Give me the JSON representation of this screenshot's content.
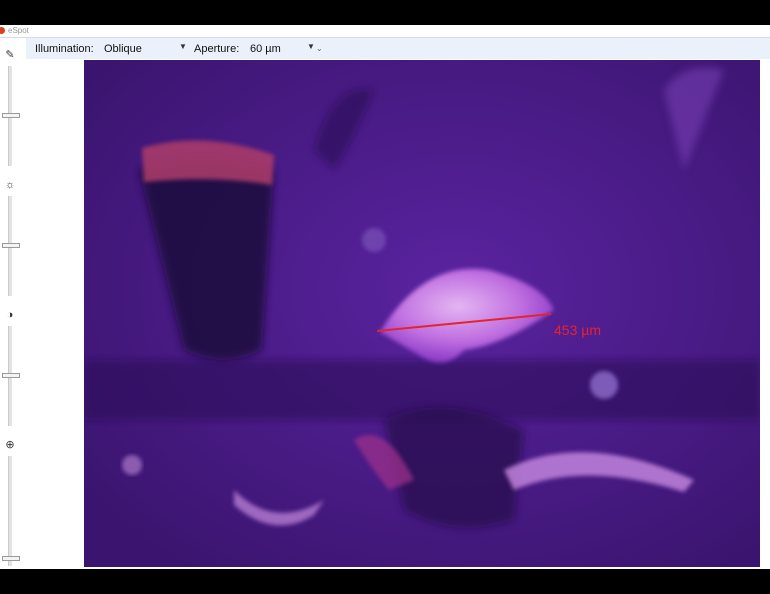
{
  "window": {
    "title": "eSpot"
  },
  "toolbar": {
    "illumination_label": "Illumination:",
    "illumination_value": "Oblique",
    "aperture_label": "Aperture:",
    "aperture_value": "60 µm"
  },
  "tools": [
    {
      "name": "pipette",
      "icon": "pipette-icon"
    },
    {
      "name": "brightness",
      "icon": "sun-icon"
    },
    {
      "name": "contrast",
      "icon": "contrast-icon"
    },
    {
      "name": "zoom",
      "icon": "zoom-in-icon"
    }
  ],
  "sliders": [
    {
      "name": "pipette-slider"
    },
    {
      "name": "brightness-slider"
    },
    {
      "name": "contrast-slider"
    },
    {
      "name": "zoom-slider"
    }
  ],
  "measurement": {
    "value": "453 µm",
    "color": "#e4232f"
  },
  "colors": {
    "toolbar_bg": "#eaf1fb",
    "image_base": "#4b1a86"
  }
}
